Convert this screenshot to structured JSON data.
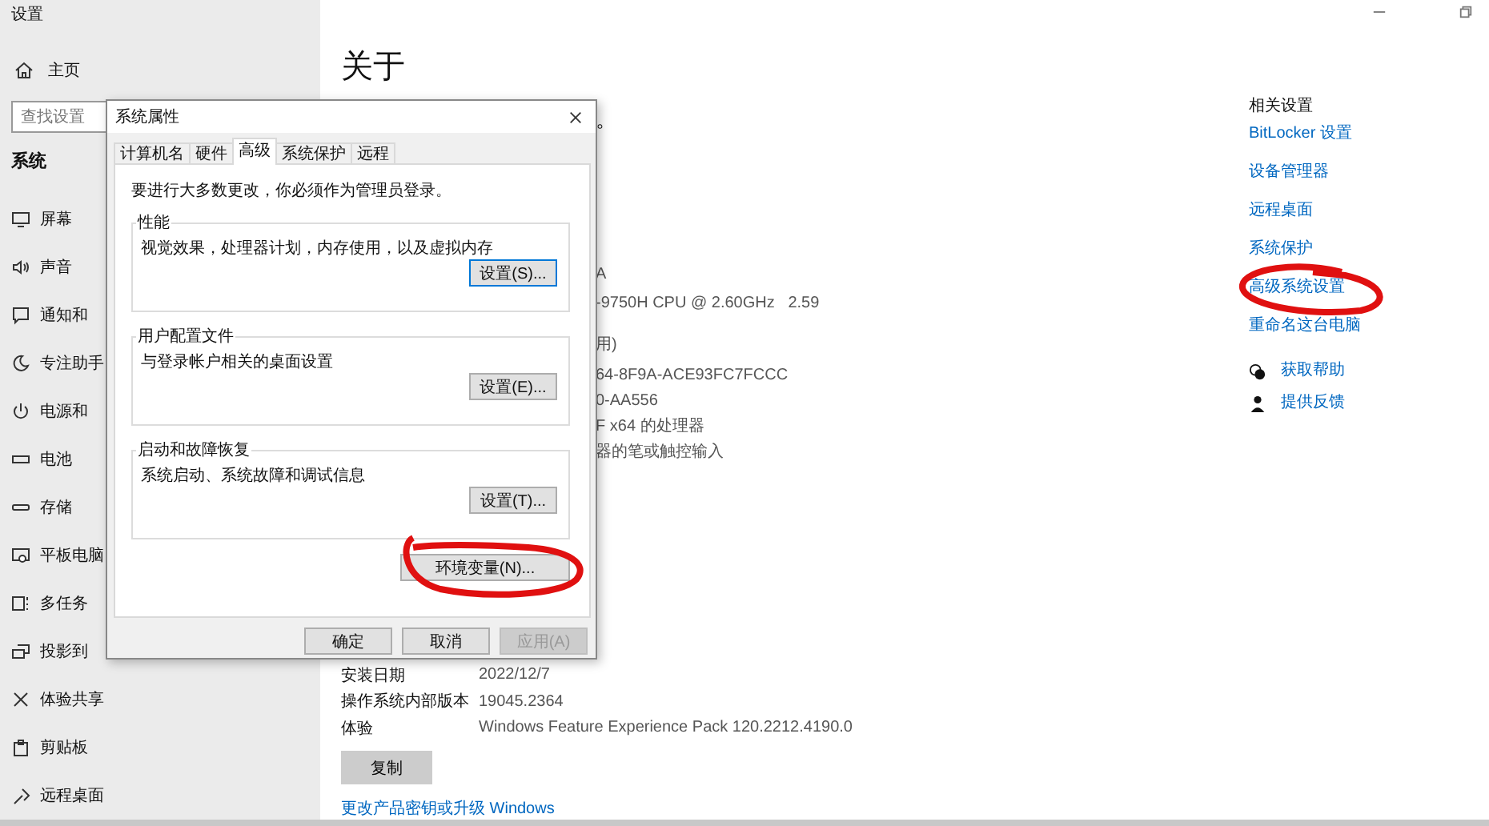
{
  "window": {
    "title": "设置"
  },
  "sidebar": {
    "home": "主页",
    "search": {
      "placeholder": "查找设置"
    },
    "section": "系统",
    "items": [
      {
        "label": "屏幕"
      },
      {
        "label": "声音"
      },
      {
        "label": "通知和"
      },
      {
        "label": "专注助手"
      },
      {
        "label": "电源和"
      },
      {
        "label": "电池"
      },
      {
        "label": "存储"
      },
      {
        "label": "平板电脑"
      },
      {
        "label": "多任务"
      },
      {
        "label": "投影到"
      },
      {
        "label": "体验共享"
      },
      {
        "label": "剪贴板"
      },
      {
        "label": "远程桌面"
      }
    ]
  },
  "main": {
    "title": "关于",
    "fragments": [
      "。",
      "A",
      "-9750H CPU @ 2.60GHz   2.59",
      "用)",
      "64-8F9A-ACE93FC7FCCC",
      "0-AA556",
      "F x64 的处理器",
      "器的笔或触控输入"
    ],
    "rows": [
      {
        "label": "安装日期",
        "value": "2022/12/7"
      },
      {
        "label": "操作系统内部版本",
        "value": "19045.2364"
      },
      {
        "label": "体验",
        "value": "Windows Feature Experience Pack 120.2212.4190.0"
      }
    ],
    "copy_button": "复制",
    "link": "更改产品密钥或升级 Windows"
  },
  "related": {
    "heading": "相关设置",
    "links": [
      "BitLocker 设置",
      "设备管理器",
      "远程桌面",
      "系统保护",
      "高级系统设置",
      "重命名这台电脑"
    ],
    "help": [
      {
        "label": "获取帮助"
      },
      {
        "label": "提供反馈"
      }
    ]
  },
  "dialog": {
    "title": "系统属性",
    "tabs": [
      {
        "label": "计算机名",
        "selected": false
      },
      {
        "label": "硬件",
        "selected": false
      },
      {
        "label": "高级",
        "selected": true
      },
      {
        "label": "系统保护",
        "selected": false
      },
      {
        "label": "远程",
        "selected": false
      }
    ],
    "notice": "要进行大多数更改，你必须作为管理员登录。",
    "groups": [
      {
        "title": "性能",
        "description": "视觉效果，处理器计划，内存使用，以及虚拟内存",
        "button": "设置(S)...",
        "focused": true
      },
      {
        "title": "用户配置文件",
        "description": "与登录帐户相关的桌面设置",
        "button": "设置(E)...",
        "focused": false
      },
      {
        "title": "启动和故障恢复",
        "description": "系统启动、系统故障和调试信息",
        "button": "设置(T)...",
        "focused": false
      }
    ],
    "env_button": "环境变量(N)...",
    "buttons": [
      {
        "label": "确定",
        "disabled": false
      },
      {
        "label": "取消",
        "disabled": false
      },
      {
        "label": "应用(A)",
        "disabled": true
      }
    ]
  }
}
